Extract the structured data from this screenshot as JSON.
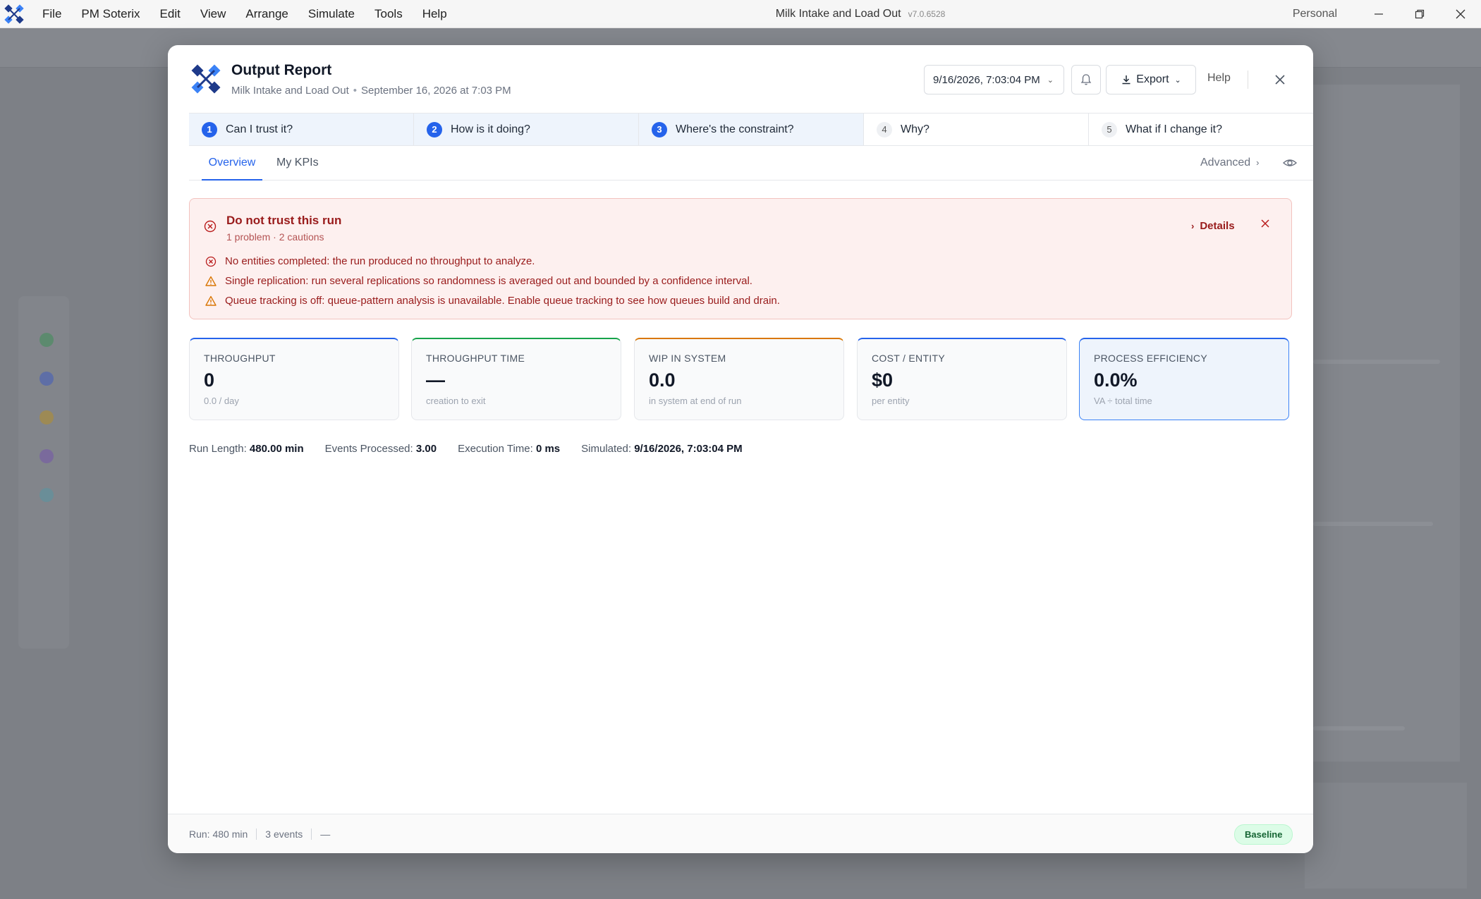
{
  "menu": [
    "File",
    "PM Soterix",
    "Edit",
    "View",
    "Arrange",
    "Simulate",
    "Tools",
    "Help"
  ],
  "window": {
    "title": "Milk Intake and Load Out",
    "version": "v7.0.6528",
    "profile": "Personal"
  },
  "report": {
    "title": "Output Report",
    "model_name": "Milk Intake and Load Out",
    "run_date": "September 16, 2026 at 7:03 PM",
    "run_selector": "9/16/2026, 7:03:04 PM",
    "export_label": "Export",
    "help_label": "Help"
  },
  "steps": [
    {
      "num": "1",
      "label": "Can I trust it?",
      "active": true
    },
    {
      "num": "2",
      "label": "How is it doing?",
      "active": true
    },
    {
      "num": "3",
      "label": "Where's the constraint?",
      "active": true
    },
    {
      "num": "4",
      "label": "Why?",
      "active": false
    },
    {
      "num": "5",
      "label": "What if I change it?",
      "active": false
    }
  ],
  "tabs": {
    "overview": "Overview",
    "kpis": "My KPIs",
    "advanced": "Advanced"
  },
  "alert": {
    "title": "Do not trust this run",
    "summary": "1 problem · 2 cautions",
    "details_label": "Details",
    "issues": [
      {
        "kind": "error",
        "text": "No entities completed: the run produced no throughput to analyze."
      },
      {
        "kind": "warning",
        "text": "Single replication: run several replications so randomness is averaged out and bounded by a confidence interval."
      },
      {
        "kind": "warning",
        "text": "Queue tracking is off: queue-pattern analysis is unavailable. Enable queue tracking to see how queues build and drain."
      }
    ]
  },
  "kpis": [
    {
      "label": "THROUGHPUT",
      "value": "0",
      "sub": "0.0 / day",
      "accent": "#2563eb"
    },
    {
      "label": "THROUGHPUT TIME",
      "value": "—",
      "sub": "creation to exit",
      "accent": "#16a34a"
    },
    {
      "label": "WIP IN SYSTEM",
      "value": "0.0",
      "sub": "in system at end of run",
      "accent": "#d97706"
    },
    {
      "label": "COST / ENTITY",
      "value": "$0",
      "sub": "per entity",
      "accent": "#2563eb"
    },
    {
      "label": "PROCESS EFFICIENCY",
      "value": "0.0%",
      "sub": "VA ÷ total time",
      "accent": "#2563eb"
    }
  ],
  "run_stats": {
    "run_length_label": "Run Length:",
    "run_length": "480.00 min",
    "events_label": "Events Processed:",
    "events": "3.00",
    "exec_label": "Execution Time:",
    "exec": "0 ms",
    "simulated_label": "Simulated:",
    "simulated": "9/16/2026, 7:03:04 PM"
  },
  "footer": {
    "run": "Run: 480 min",
    "events": "3 events",
    "extra": "—",
    "badge": "Baseline"
  },
  "colors": {
    "accent": "#2563eb",
    "error": "#991b1b",
    "warning": "#d97706",
    "success": "#166534"
  }
}
